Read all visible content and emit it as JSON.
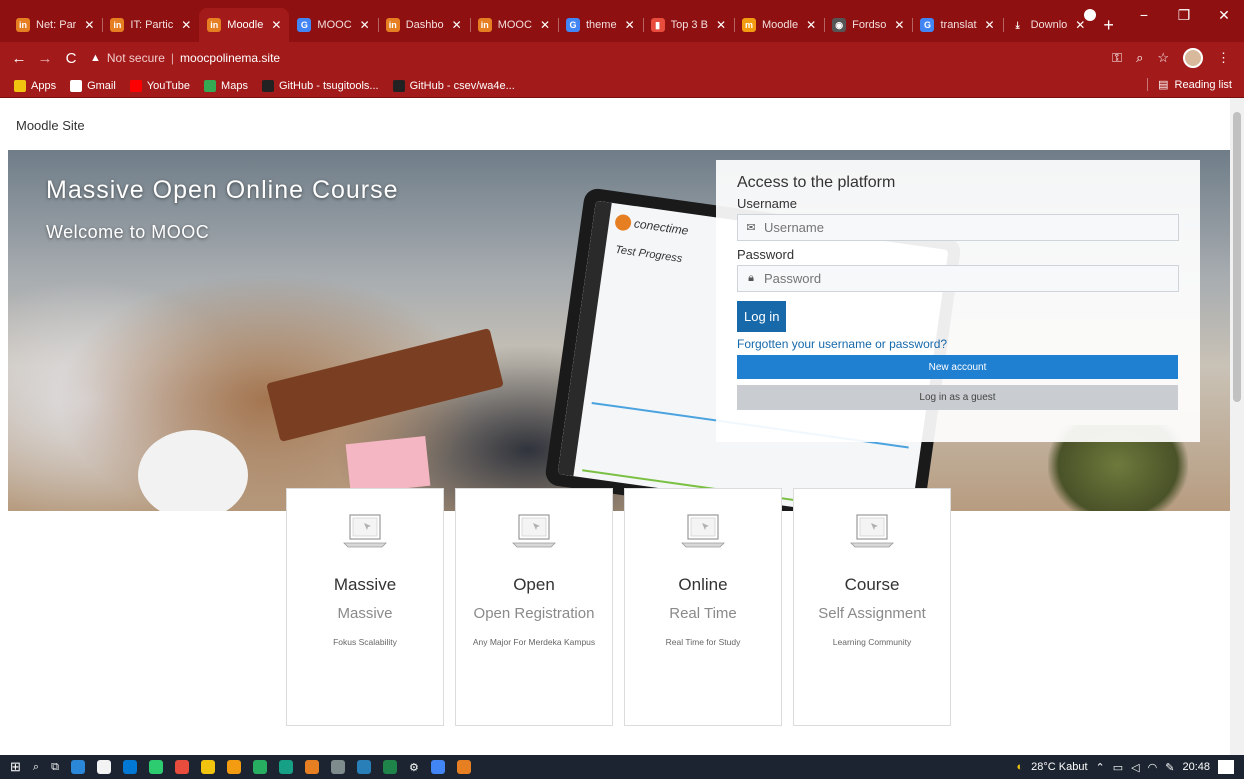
{
  "browser": {
    "tabs": [
      {
        "label": "Net: Par",
        "favicon_text": "in",
        "favicon_color": "#e67e22",
        "active": false
      },
      {
        "label": "IT: Partic",
        "favicon_text": "in",
        "favicon_color": "#e67e22",
        "active": false
      },
      {
        "label": "Moodle",
        "favicon_text": "in",
        "favicon_color": "#e67e22",
        "active": true
      },
      {
        "label": "MOOC",
        "favicon_text": "G",
        "favicon_color": "#4285f4",
        "active": false
      },
      {
        "label": "Dashbo",
        "favicon_text": "in",
        "favicon_color": "#e67e22",
        "active": false
      },
      {
        "label": "MOOC",
        "favicon_text": "in",
        "favicon_color": "#e67e22",
        "active": false
      },
      {
        "label": "theme",
        "favicon_text": "G",
        "favicon_color": "#4285f4",
        "active": false
      },
      {
        "label": "Top 3 B",
        "favicon_text": "▮",
        "favicon_color": "#e74c3c",
        "active": false
      },
      {
        "label": "Moodle",
        "favicon_text": "m",
        "favicon_color": "#f39c12",
        "active": false
      },
      {
        "label": "Fordso",
        "favicon_text": "◉",
        "favicon_color": "#555555",
        "active": false
      },
      {
        "label": "translat",
        "favicon_text": "G",
        "favicon_color": "#4285f4",
        "active": false
      },
      {
        "label": "Downlo",
        "favicon_text": "⤓",
        "favicon_color": "#8f1010",
        "active": false
      }
    ],
    "new_tab": "+",
    "address": {
      "security": "Not secure",
      "url": "moocpolinema.site"
    },
    "bookmarks": [
      {
        "label": "Apps",
        "color": "#f1c40f"
      },
      {
        "label": "Gmail",
        "color": "#ffffff"
      },
      {
        "label": "YouTube",
        "color": "#ff0000"
      },
      {
        "label": "Maps",
        "color": "#34a853"
      },
      {
        "label": "GitHub - tsugitools...",
        "color": "#222222"
      },
      {
        "label": "GitHub - csev/wa4e...",
        "color": "#222222"
      }
    ],
    "reading_list": "Reading list"
  },
  "page": {
    "site_name": "Moodle Site",
    "hero": {
      "title": "Massive Open Online Course",
      "subtitle": "Welcome to MOOC",
      "laptop_brand": "conectime",
      "laptop_heading": "Test Progress"
    },
    "login": {
      "heading": "Access to the platform",
      "username_label": "Username",
      "username_placeholder": "Username",
      "password_label": "Password",
      "password_placeholder": "Password",
      "login_button": "Log in",
      "forgot_link": "Forgotten your username or password?",
      "new_account_button": "New account",
      "guest_button": "Log in as a guest"
    },
    "cards": [
      {
        "title": "Massive",
        "subtitle": "Massive",
        "description": "Fokus Scalability"
      },
      {
        "title": "Open",
        "subtitle": "Open Registration",
        "description": "Any Major For Merdeka Kampus"
      },
      {
        "title": "Online",
        "subtitle": "Real Time",
        "description": "Real Time for Study"
      },
      {
        "title": "Course",
        "subtitle": "Self Assignment",
        "description": "Learning Community"
      }
    ]
  },
  "taskbar": {
    "weather": "28°C Kabut",
    "time": "20:48"
  },
  "colors": {
    "browser_frame": "#8f1010",
    "accent_blue": "#1769aa",
    "new_account_blue": "#1f7fd1"
  }
}
